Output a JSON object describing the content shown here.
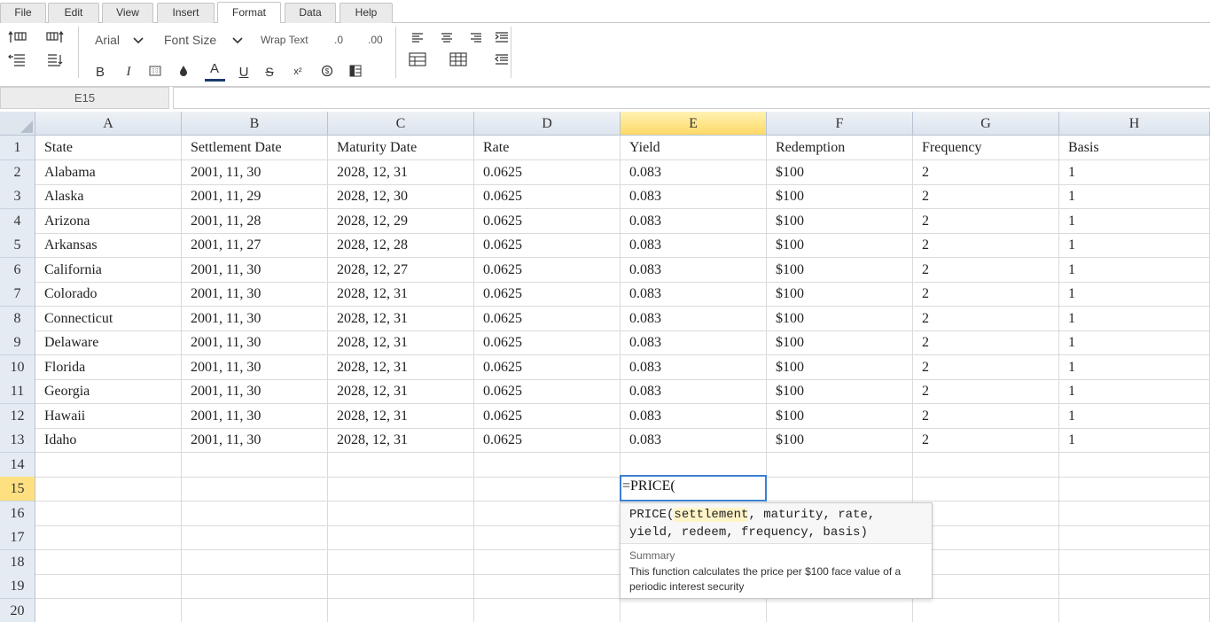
{
  "menu": {
    "tabs": [
      {
        "label": "File"
      },
      {
        "label": "Edit"
      },
      {
        "label": "View"
      },
      {
        "label": "Insert"
      },
      {
        "label": "Format"
      },
      {
        "label": "Data"
      },
      {
        "label": "Help"
      }
    ],
    "active_tab": "Format"
  },
  "ribbon": {
    "font_family": "Arial",
    "font_size_label": "Font Size",
    "wrap_text_label": "Wrap Text",
    "decimal_decrease_label": ".0",
    "decimal_increase_label": ".00",
    "bold_label": "B",
    "italic_label": "I",
    "font_color_label": "A",
    "underline_label": "U",
    "strike_label": "S",
    "superscript_label": "x²",
    "currency_label": "$"
  },
  "formula_bar": {
    "cell_ref": "E15",
    "formula": ""
  },
  "grid": {
    "selected_column": "E",
    "selected_row": "15",
    "columns": [
      "A",
      "B",
      "C",
      "D",
      "E",
      "F",
      "G",
      "H"
    ],
    "row_numbers": [
      "1",
      "2",
      "3",
      "4",
      "5",
      "6",
      "7",
      "8",
      "9",
      "10",
      "11",
      "12",
      "13",
      "14",
      "15",
      "16",
      "17",
      "18",
      "19",
      "20"
    ],
    "rows": [
      [
        "State",
        "Settlement Date",
        "Maturity Date",
        "Rate",
        "Yield",
        "Redemption",
        "Frequency",
        "Basis"
      ],
      [
        "Alabama",
        "2001, 11, 30",
        "2028, 12, 31",
        "0.0625",
        "0.083",
        "$100",
        "2",
        "1"
      ],
      [
        "Alaska",
        "2001, 11, 29",
        "2028, 12, 30",
        "0.0625",
        "0.083",
        "$100",
        "2",
        "1"
      ],
      [
        "Arizona",
        "2001, 11, 28",
        "2028, 12, 29",
        "0.0625",
        "0.083",
        "$100",
        "2",
        "1"
      ],
      [
        "Arkansas",
        "2001, 11, 27",
        "2028, 12, 28",
        "0.0625",
        "0.083",
        "$100",
        "2",
        "1"
      ],
      [
        "California",
        "2001, 11, 30",
        "2028, 12, 27",
        "0.0625",
        "0.083",
        "$100",
        "2",
        "1"
      ],
      [
        "Colorado",
        "2001, 11, 30",
        "2028, 12, 31",
        "0.0625",
        "0.083",
        "$100",
        "2",
        "1"
      ],
      [
        "Connecticut",
        "2001, 11, 30",
        "2028, 12, 31",
        "0.0625",
        "0.083",
        "$100",
        "2",
        "1"
      ],
      [
        "Delaware",
        "2001, 11, 30",
        "2028, 12, 31",
        "0.0625",
        "0.083",
        "$100",
        "2",
        "1"
      ],
      [
        "Florida",
        "2001, 11, 30",
        "2028, 12, 31",
        "0.0625",
        "0.083",
        "$100",
        "2",
        "1"
      ],
      [
        "Georgia",
        "2001, 11, 30",
        "2028, 12, 31",
        "0.0625",
        "0.083",
        "$100",
        "2",
        "1"
      ],
      [
        "Hawaii",
        "2001, 11, 30",
        "2028, 12, 31",
        "0.0625",
        "0.083",
        "$100",
        "2",
        "1"
      ],
      [
        "Idaho",
        "2001, 11, 30",
        "2028, 12, 31",
        "0.0625",
        "0.083",
        "$100",
        "2",
        "1"
      ],
      [
        "",
        "",
        "",
        "",
        "",
        "",
        "",
        ""
      ],
      [
        "",
        "",
        "",
        "",
        "",
        "",
        "",
        ""
      ],
      [
        "",
        "",
        "",
        "",
        "",
        "",
        "",
        ""
      ],
      [
        "",
        "",
        "",
        "",
        "",
        "",
        "",
        ""
      ],
      [
        "",
        "",
        "",
        "",
        "",
        "",
        "",
        ""
      ],
      [
        "",
        "",
        "",
        "",
        "",
        "",
        "",
        ""
      ],
      [
        "",
        "",
        "",
        "",
        "",
        "",
        "",
        ""
      ]
    ]
  },
  "editor": {
    "value": "=PRICE("
  },
  "tooltip": {
    "fn_name": "PRICE(",
    "active_param": "settlement",
    "rest_line1": ", maturity, rate,",
    "line2": "yield, redeem, frequency, basis)",
    "summary_title": "Summary",
    "summary": "This function calculates the price per $100 face value of a periodic interest security"
  },
  "colors": {
    "selection_border": "#3b7ed0",
    "header_selected": "#ffd966",
    "header_bg": "#dce4ee"
  }
}
